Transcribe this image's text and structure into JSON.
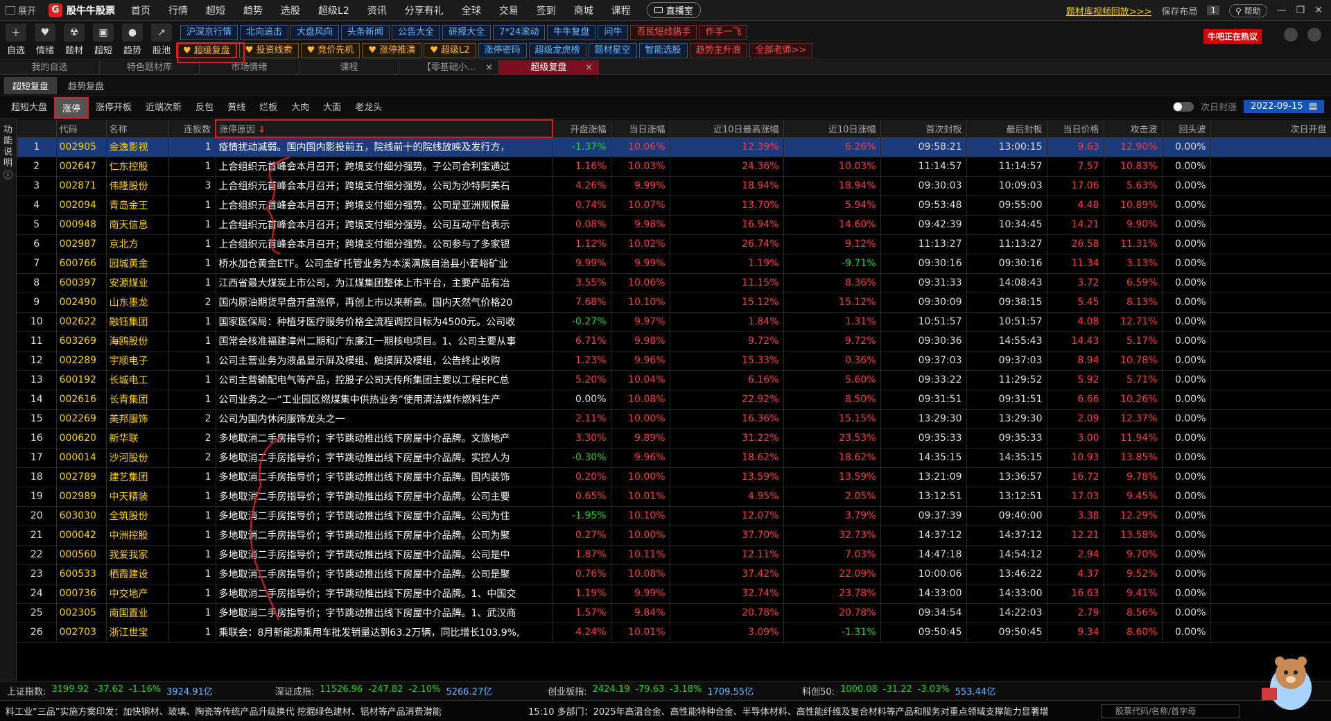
{
  "topbar": {
    "expand_label": "展开",
    "logo_text": "股牛牛股票",
    "logo_mark": "G",
    "menu": [
      "首页",
      "行情",
      "超短",
      "趋势",
      "选股",
      "超级L2",
      "资讯",
      "分享有礼",
      "全球",
      "交易",
      "签到",
      "商城",
      "课程"
    ],
    "live_label": "直播室",
    "replay_link": "题材库视频回放>>>",
    "save_layout": "保存布局",
    "badge_num": "1",
    "help_label": "帮助"
  },
  "toolbar": {
    "icons": [
      {
        "label": "自选",
        "glyph": "＋"
      },
      {
        "label": "情绪",
        "glyph": "♥"
      },
      {
        "label": "题材",
        "glyph": "☢"
      },
      {
        "label": "超短",
        "glyph": "▣"
      },
      {
        "label": "趋势",
        "glyph": "●"
      },
      {
        "label": "股池",
        "glyph": "↗"
      }
    ],
    "row1": [
      "沪深京行情",
      "北向追击",
      "大盘风向",
      "头条新闻",
      "公告大全",
      "研报大全",
      "7*24滚动",
      "牛牛复盘",
      "问牛"
    ],
    "row1_red": [
      "吾民短线猎手",
      "作手一飞"
    ],
    "row2_gold": [
      "超级复盘",
      "投资线索",
      "竞价先机",
      "涨停推演",
      "超级L2"
    ],
    "row2": [
      "涨停密码",
      "超级龙虎榜",
      "题材星空",
      "智能选股"
    ],
    "row2_red": [
      "趋势主升浪",
      "全部老师>>"
    ],
    "hot_badge": "牛吧正在热议"
  },
  "tabs": [
    {
      "label": "我的自选",
      "active": false
    },
    {
      "label": "特色题材库",
      "active": false
    },
    {
      "label": "市场情绪",
      "active": false
    },
    {
      "label": "课程",
      "active": false
    },
    {
      "label": "【零基础小...",
      "active": false
    },
    {
      "label": "超级复盘",
      "active": true
    }
  ],
  "subtabs": [
    "超短复盘",
    "趋势复盘"
  ],
  "filters": [
    "超短大盘",
    "涨停",
    "涨停开板",
    "近端次新",
    "反包",
    "黄线",
    "烂板",
    "大肉",
    "大面",
    "老龙头"
  ],
  "filter_right": {
    "toggle_label": "次日封涨",
    "date": "2022-09-15"
  },
  "side_label": "功能说明",
  "table": {
    "headers": [
      "",
      "代码",
      "名称",
      "连板数",
      "涨停原因",
      "开盘涨幅",
      "当日涨幅",
      "近10日最高涨幅",
      "近10日涨幅",
      "首次封板",
      "最后封板",
      "当日价格",
      "攻击波",
      "回头波",
      "次日开盘"
    ],
    "rows": [
      [
        "1",
        "002905",
        "金逸影视",
        "1",
        "疫情扰动减弱。国内国内影投前五，院线前十的院线放映及发行方，",
        "-1.37%",
        "10.06%",
        "12.39%",
        "6.26%",
        "09:58:21",
        "13:00:15",
        "9.63",
        "12.90%",
        "0.00%",
        ""
      ],
      [
        "2",
        "002647",
        "仁东控股",
        "1",
        "上合组织元首峰会本月召开；跨境支付细分强势。子公司合利宝通过",
        "1.16%",
        "10.03%",
        "24.36%",
        "10.03%",
        "11:14:57",
        "11:14:57",
        "7.57",
        "10.83%",
        "0.00%",
        ""
      ],
      [
        "3",
        "002871",
        "伟隆股份",
        "3",
        "上合组织元首峰会本月召开；跨境支付细分强势。公司为沙特阿美石",
        "4.26%",
        "9.99%",
        "18.94%",
        "18.94%",
        "09:30:03",
        "10:09:03",
        "17.06",
        "5.63%",
        "0.00%",
        ""
      ],
      [
        "4",
        "002094",
        "青岛金王",
        "1",
        "上合组织元首峰会本月召开；跨境支付细分强势。公司是亚洲规模最",
        "0.74%",
        "10.07%",
        "13.70%",
        "5.94%",
        "09:53:48",
        "09:55:00",
        "4.48",
        "10.89%",
        "0.00%",
        ""
      ],
      [
        "5",
        "000948",
        "南天信息",
        "1",
        "上合组织元首峰会本月召开；跨境支付细分强势。公司互动平台表示",
        "0.08%",
        "9.98%",
        "16.94%",
        "14.60%",
        "09:42:39",
        "10:34:45",
        "14.21",
        "9.90%",
        "0.00%",
        ""
      ],
      [
        "6",
        "002987",
        "京北方",
        "1",
        "上合组织元首峰会本月召开；跨境支付细分强势。公司参与了多家银",
        "1.12%",
        "10.02%",
        "26.74%",
        "9.12%",
        "11:13:27",
        "11:13:27",
        "26.58",
        "11.31%",
        "0.00%",
        ""
      ],
      [
        "7",
        "600766",
        "园城黄金",
        "1",
        "桥水加仓黄金ETF。公司金矿托管业务为本溪满族自治县小套峪矿业",
        "9.99%",
        "9.99%",
        "1.19%",
        "-9.71%",
        "09:30:16",
        "09:30:16",
        "11.34",
        "3.13%",
        "0.00%",
        ""
      ],
      [
        "8",
        "600397",
        "安源煤业",
        "1",
        "江西省最大煤炭上市公司，为江煤集团整体上市平台，主要产品有冶",
        "3.55%",
        "10.06%",
        "11.15%",
        "8.36%",
        "09:31:33",
        "14:08:43",
        "3.72",
        "6.59%",
        "0.00%",
        ""
      ],
      [
        "9",
        "002490",
        "山东墨龙",
        "2",
        "国内原油期货早盘开盘涨停，再创上市以来新高。国内天然气价格20",
        "7.68%",
        "10.10%",
        "15.12%",
        "15.12%",
        "09:30:09",
        "09:38:15",
        "5.45",
        "8.13%",
        "0.00%",
        ""
      ],
      [
        "10",
        "002622",
        "融钰集团",
        "1",
        "国家医保局：种植牙医疗服务价格全流程调控目标为4500元。公司收",
        "-0.27%",
        "9.97%",
        "1.84%",
        "1.31%",
        "10:51:57",
        "10:51:57",
        "4.08",
        "12.71%",
        "0.00%",
        ""
      ],
      [
        "11",
        "603269",
        "海鸥股份",
        "1",
        "国常会核准福建漳州二期和广东廉江一期核电项目。1、公司主要从事",
        "6.71%",
        "9.98%",
        "9.72%",
        "9.72%",
        "09:30:36",
        "14:55:43",
        "14.43",
        "5.17%",
        "0.00%",
        ""
      ],
      [
        "12",
        "002289",
        "宇顺电子",
        "1",
        "公司主营业务为液晶显示屏及模组、触摸屏及模组，公告终止收购",
        "1.23%",
        "9.96%",
        "15.33%",
        "0.36%",
        "09:37:03",
        "09:37:03",
        "8.94",
        "10.78%",
        "0.00%",
        ""
      ],
      [
        "13",
        "600192",
        "长城电工",
        "1",
        "公司主营输配电气等产品，控股子公司天传所集团主要以工程EPC总",
        "5.20%",
        "10.04%",
        "6.16%",
        "5.60%",
        "09:33:22",
        "11:29:52",
        "5.92",
        "5.71%",
        "0.00%",
        ""
      ],
      [
        "14",
        "002616",
        "长青集团",
        "1",
        "公司业务之一“工业园区燃煤集中供热业务”使用清洁煤作燃料生产",
        "0.00%",
        "10.08%",
        "22.92%",
        "8.50%",
        "09:31:51",
        "09:31:51",
        "6.66",
        "10.26%",
        "0.00%",
        ""
      ],
      [
        "15",
        "002269",
        "美邦服饰",
        "2",
        "公司为国内休闲服饰龙头之一",
        "2.11%",
        "10.00%",
        "16.36%",
        "15.15%",
        "13:29:30",
        "13:29:30",
        "2.09",
        "12.37%",
        "0.00%",
        ""
      ],
      [
        "16",
        "000620",
        "新华联",
        "2",
        "多地取消二手房指导价；字节跳动推出线下房屋中介品牌。文旅地产",
        "3.30%",
        "9.89%",
        "31.22%",
        "23.53%",
        "09:35:33",
        "09:35:33",
        "3.00",
        "11.94%",
        "0.00%",
        ""
      ],
      [
        "17",
        "000014",
        "沙河股份",
        "2",
        "多地取消二手房指导价；字节跳动推出线下房屋中介品牌。实控人为",
        "-0.30%",
        "9.96%",
        "18.62%",
        "18.62%",
        "14:35:15",
        "14:35:15",
        "10.93",
        "13.85%",
        "0.00%",
        ""
      ],
      [
        "18",
        "002789",
        "建艺集团",
        "1",
        "多地取消二手房指导价；字节跳动推出线下房屋中介品牌。国内装饰",
        "0.20%",
        "10.00%",
        "13.59%",
        "13.59%",
        "13:21:09",
        "13:36:57",
        "16.72",
        "9.78%",
        "0.00%",
        ""
      ],
      [
        "19",
        "002989",
        "中天精装",
        "1",
        "多地取消二手房指导价；字节跳动推出线下房屋中介品牌。公司主要",
        "0.65%",
        "10.01%",
        "4.95%",
        "2.05%",
        "13:12:51",
        "13:12:51",
        "17.03",
        "9.45%",
        "0.00%",
        ""
      ],
      [
        "20",
        "603030",
        "全筑股份",
        "1",
        "多地取消二手房指导价；字节跳动推出线下房屋中介品牌。公司为住",
        "-1.95%",
        "10.10%",
        "12.07%",
        "3.79%",
        "09:37:39",
        "09:40:00",
        "3.38",
        "12.29%",
        "0.00%",
        ""
      ],
      [
        "21",
        "000042",
        "中洲控股",
        "1",
        "多地取消二手房指导价；字节跳动推出线下房屋中介品牌。公司为聚",
        "0.27%",
        "10.00%",
        "37.70%",
        "32.73%",
        "14:37:12",
        "14:37:12",
        "12.21",
        "13.58%",
        "0.00%",
        ""
      ],
      [
        "22",
        "000560",
        "我爱我家",
        "1",
        "多地取消二手房指导价；字节跳动推出线下房屋中介品牌。公司是中",
        "1.87%",
        "10.11%",
        "12.11%",
        "7.03%",
        "14:47:18",
        "14:54:12",
        "2.94",
        "9.70%",
        "0.00%",
        ""
      ],
      [
        "23",
        "600533",
        "栖霞建设",
        "1",
        "多地取消二手房指导价；字节跳动推出线下房屋中介品牌。公司是聚",
        "0.76%",
        "10.08%",
        "37.42%",
        "22.09%",
        "10:00:06",
        "13:46:22",
        "4.37",
        "9.52%",
        "0.00%",
        ""
      ],
      [
        "24",
        "000736",
        "中交地产",
        "1",
        "多地取消二手房指导价；字节跳动推出线下房屋中介品牌。1、中国交",
        "1.19%",
        "9.99%",
        "32.74%",
        "23.78%",
        "14:33:00",
        "14:33:00",
        "16.63",
        "9.41%",
        "0.00%",
        ""
      ],
      [
        "25",
        "002305",
        "南国置业",
        "1",
        "多地取消二手房指导价；字节跳动推出线下房屋中介品牌。1、武汉商",
        "1.57%",
        "9.84%",
        "20.78%",
        "20.78%",
        "09:34:54",
        "14:22:03",
        "2.79",
        "8.56%",
        "0.00%",
        ""
      ],
      [
        "26",
        "002703",
        "浙江世宝",
        "1",
        "乘联会：8月新能源乘用车批发销量达到63.2万辆，同比增长103.9%,",
        "4.24%",
        "10.01%",
        "3.09%",
        "-1.31%",
        "09:50:45",
        "09:50:45",
        "9.34",
        "8.60%",
        "0.00%",
        ""
      ]
    ]
  },
  "status": [
    {
      "label": "上证指数:",
      "value": "3199.92",
      "change": "-37.62",
      "pct": "-1.16%",
      "amount": "3924.91亿"
    },
    {
      "label": "深证成指:",
      "value": "11526.96",
      "change": "-247.82",
      "pct": "-2.10%",
      "amount": "5266.27亿"
    },
    {
      "label": "创业板指:",
      "value": "2424.19",
      "change": "-79.63",
      "pct": "-3.18%",
      "amount": "1709.55亿"
    },
    {
      "label": "科创50:",
      "value": "1000.08",
      "change": "-31.22",
      "pct": "-3.03%",
      "amount": "553.44亿"
    }
  ],
  "ticker": {
    "left": "料工业“三品”实施方案印发：加快钢材、玻璃、陶瓷等传统产品升级换代 挖掘绿色建材、铝材等产品消费潜能",
    "right": "15:10 多部门：2025年高温合金、高性能特种合金、半导体材料、高性能纤维及复合材料等产品和服务对重点领域支撑能力显著增",
    "search_placeholder": "股票代码/名称/首字母"
  },
  "colors": {
    "rise": "#ff3838",
    "fall": "#19d419",
    "code": "#ffd100",
    "selected_row": "#1c3b7c",
    "annotation": "#e31b1b"
  }
}
